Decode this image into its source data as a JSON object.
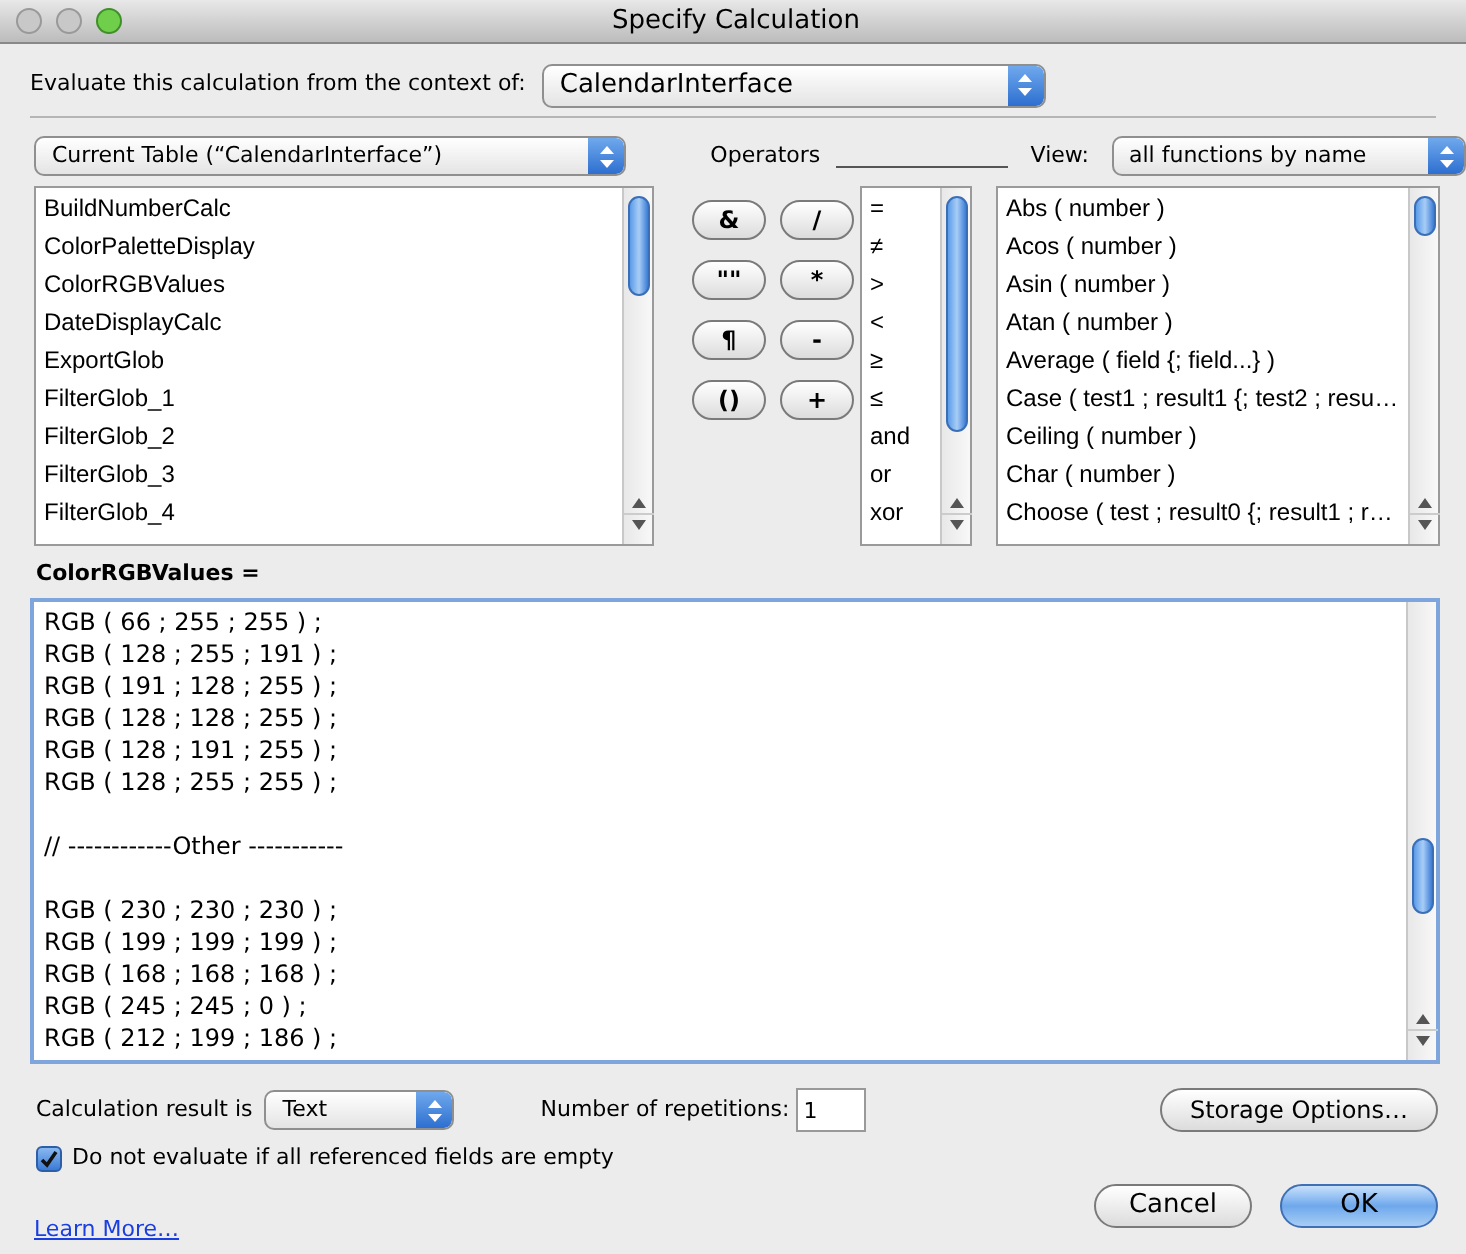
{
  "window": {
    "title": "Specify Calculation"
  },
  "context": {
    "label": "Evaluate this calculation from the context of:",
    "value": "CalendarInterface"
  },
  "table_popup": {
    "value": "Current Table (“CalendarInterface”)"
  },
  "fields": [
    "BuildNumberCalc",
    "ColorPaletteDisplay",
    "ColorRGBValues",
    "DateDisplayCalc",
    "ExportGlob",
    "FilterGlob_1",
    "FilterGlob_2",
    "FilterGlob_3",
    "FilterGlob_4"
  ],
  "operators_label": "Operators",
  "operator_buttons": [
    "&",
    "/",
    "\"\"",
    "*",
    "¶",
    "-",
    "()",
    "+"
  ],
  "operators": [
    "=",
    "≠",
    ">",
    "<",
    "≥",
    "≤",
    "and",
    "or",
    "xor"
  ],
  "view": {
    "label": "View:",
    "value": "all functions by name"
  },
  "functions": [
    "Abs ( number )",
    "Acos ( number )",
    "Asin ( number )",
    "Atan ( number )",
    "Average ( field {; field...} )",
    "Case ( test1 ; result1 {; test2 ; resu…",
    "Ceiling ( number )",
    "Char ( number )",
    "Choose ( test ; result0 {; result1 ; r…"
  ],
  "formula_label": "ColorRGBValues =",
  "formula_blocks": [
    [
      "RGB ( 66 ; 255 ; 255 ) ;",
      "RGB ( 128 ; 255 ; 191 ) ;",
      "RGB ( 191 ; 128 ; 255 ) ;",
      "RGB ( 128 ; 128 ; 255 ) ;",
      "RGB ( 128 ; 191 ; 255 ) ;",
      "RGB ( 128 ; 255 ; 255 ) ;"
    ],
    [
      "// ------------Other -----------"
    ],
    [
      "RGB ( 230 ; 230 ; 230 ) ;",
      "RGB ( 199 ; 199 ; 199 ) ;",
      "RGB ( 168 ; 168 ; 168 ) ;",
      "RGB ( 245 ; 245 ; 0 ) ;",
      "RGB ( 212 ; 199 ; 186 ) ;"
    ]
  ],
  "result_type": {
    "label": "Calculation result is",
    "value": "Text"
  },
  "repetitions": {
    "label": "Number of repetitions:",
    "value": "1"
  },
  "storage_button": "Storage Options…",
  "skip_empty": {
    "label": "Do not evaluate if all referenced fields are empty",
    "checked": true
  },
  "learn_more": "Learn More…",
  "buttons": [
    {
      "label": "Cancel",
      "default": false
    },
    {
      "label": "OK",
      "default": true
    }
  ]
}
